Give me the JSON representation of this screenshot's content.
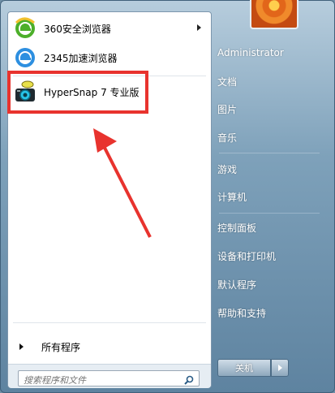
{
  "left": {
    "pinned": [
      {
        "label": "360安全浏览器",
        "icon": "browser-360-icon",
        "has_submenu": true
      },
      {
        "label": "2345加速浏览器",
        "icon": "browser-2345-icon",
        "has_submenu": false
      }
    ],
    "recent": [
      {
        "label": "HyperSnap 7 专业版",
        "icon": "hypersnap-camera-icon"
      }
    ],
    "all_programs": "所有程序",
    "search_placeholder": "搜索程序和文件"
  },
  "right": {
    "items": [
      "Administrator",
      "文档",
      "图片",
      "音乐",
      "游戏",
      "计算机",
      "控制面板",
      "设备和打印机",
      "默认程序",
      "帮助和支持"
    ]
  },
  "shutdown": {
    "label": "关机"
  },
  "colors": {
    "highlight_box": "#e8332e",
    "arrow": "#e8332e"
  }
}
